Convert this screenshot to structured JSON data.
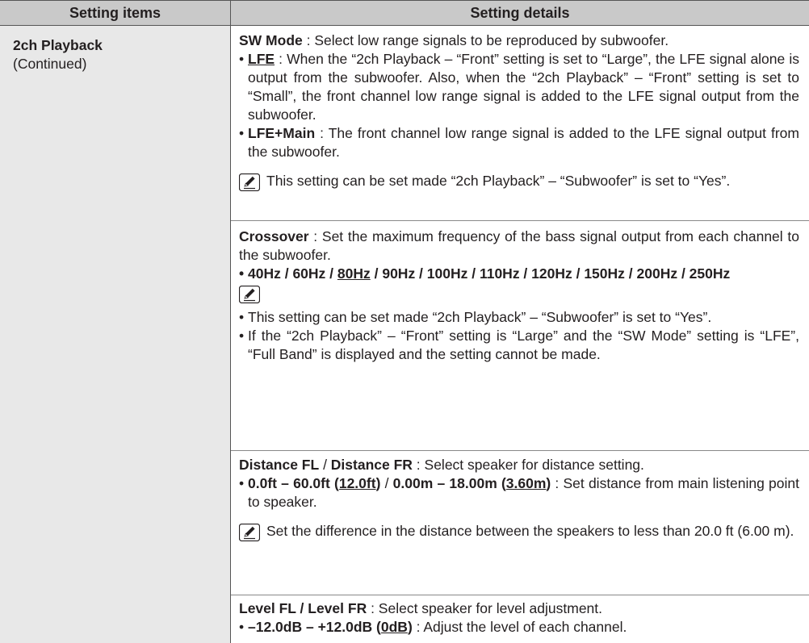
{
  "header": {
    "col1": "Setting items",
    "col2": "Setting details"
  },
  "left": {
    "title": "2ch Playback",
    "sub": "(Continued)"
  },
  "sw_mode": {
    "title": "SW Mode",
    "desc": " : Select low range signals to be reproduced by subwoofer.",
    "lfe_label": "LFE",
    "lfe_text": " : When the “2ch Playback – “Front” setting is set to “Large”, the LFE signal alone is output from the subwoofer. Also, when the “2ch Playback” – “Front” setting is set to “Small”, the front channel low range signal is added to the LFE signal output from the subwoofer.",
    "lfemain_label": "LFE+Main",
    "lfemain_text": " : The front channel low range signal is added to the LFE signal output from the subwoofer.",
    "note": "This setting can be set made “2ch Playback” – “Subwoofer” is set to “Yes”."
  },
  "crossover": {
    "title": "Crossover",
    "desc": " : Set the maximum frequency of the bass signal output from each channel to the subwoofer.",
    "opt_pre": "40Hz / 60Hz / ",
    "opt_default": "80Hz",
    "opt_post": " / 90Hz / 100Hz / 110Hz / 120Hz / 150Hz / 200Hz / 250Hz",
    "note1": "This setting can be set made “2ch Playback” – “Subwoofer” is set to “Yes”.",
    "note2": "If the “2ch Playback” – “Front” setting is “Large” and the “SW Mode” setting is “LFE”, “Full Band” is displayed and the setting cannot be made."
  },
  "distance": {
    "title_a": "Distance FL",
    "slash": " / ",
    "title_b": "Distance FR",
    "desc": " : Select speaker for distance setting.",
    "range_ft": "0.0ft – 60.0ft (",
    "default_ft": "12.0ft",
    "close1": ")",
    "mid": " / ",
    "range_m": "0.00m – 18.00m (",
    "default_m": "3.60m",
    "close2": ")",
    "range_text": " : Set distance from main listening point to speaker.",
    "note": "Set the difference in the distance between the speakers to less than 20.0 ft (6.00 m)."
  },
  "level": {
    "title": "Level FL / Level FR",
    "desc": " : Select speaker for level adjustment.",
    "range": "–12.0dB – +12.0dB (",
    "default": "0dB",
    "close": ")",
    "text": " : Adjust the level of each channel."
  }
}
